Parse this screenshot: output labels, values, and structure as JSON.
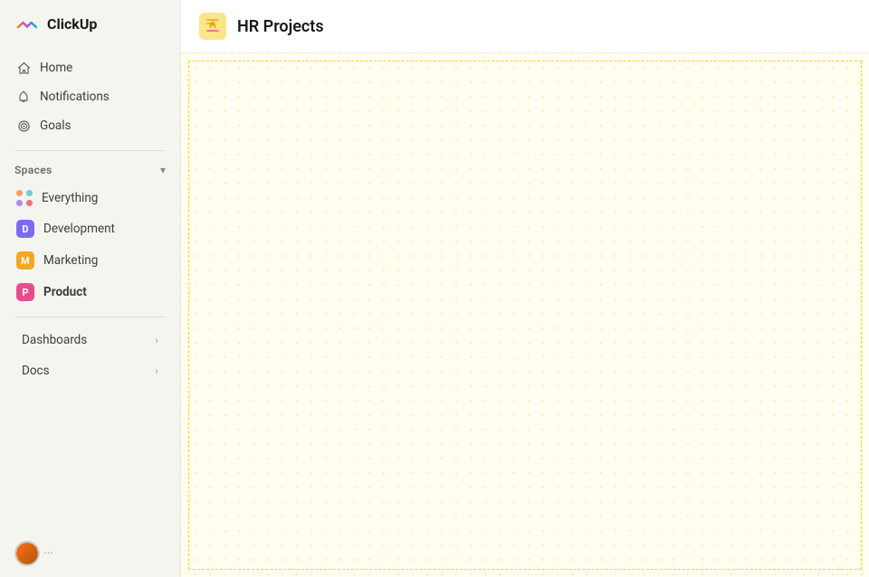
{
  "app": {
    "logo_text": "ClickUp"
  },
  "sidebar": {
    "nav": [
      {
        "id": "home",
        "label": "Home",
        "icon": "home-icon"
      },
      {
        "id": "notifications",
        "label": "Notifications",
        "icon": "bell-icon"
      },
      {
        "id": "goals",
        "label": "Goals",
        "icon": "goals-icon"
      }
    ],
    "spaces_label": "Spaces",
    "spaces": [
      {
        "id": "everything",
        "label": "Everything",
        "icon": "everything-icon",
        "badge": null
      },
      {
        "id": "development",
        "label": "Development",
        "badge": "D",
        "badge_class": "badge-d"
      },
      {
        "id": "marketing",
        "label": "Marketing",
        "badge": "M",
        "badge_class": "badge-m"
      },
      {
        "id": "product",
        "label": "Product",
        "badge": "P",
        "badge_class": "badge-p",
        "active": true
      }
    ],
    "sections": [
      {
        "id": "dashboards",
        "label": "Dashboards"
      },
      {
        "id": "docs",
        "label": "Docs"
      }
    ]
  },
  "main": {
    "title": "HR Projects",
    "icon": "hr-projects-icon"
  }
}
